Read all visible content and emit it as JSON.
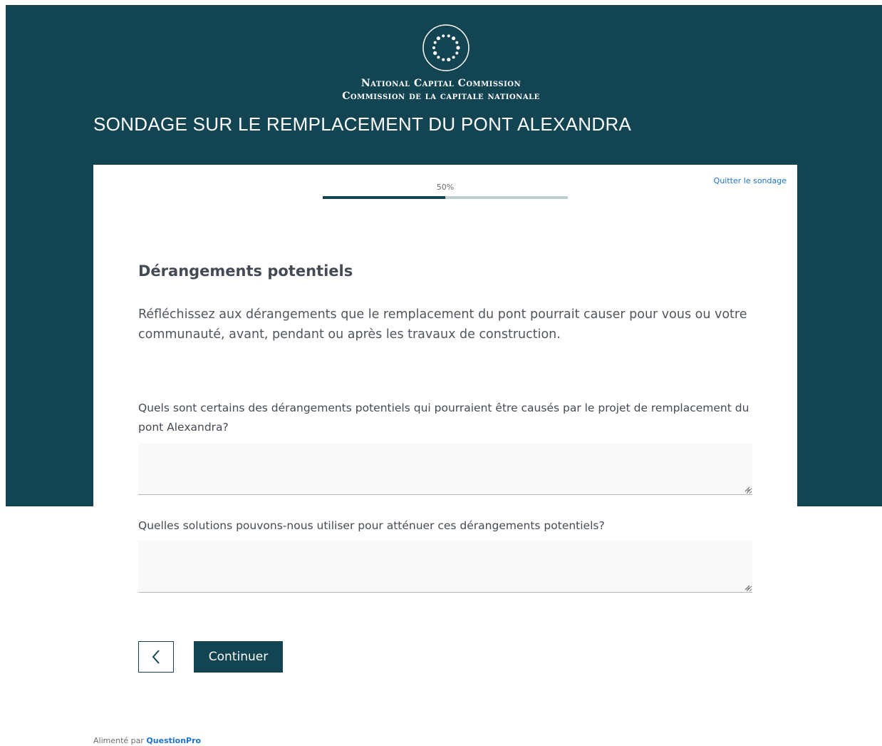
{
  "header": {
    "logo_icon": "ncc-circle-of-dots-logo-icon",
    "org_name_en": "National Capital Commission",
    "org_name_fr": "Commission de la capitale nationale",
    "survey_title": "SONDAGE SUR LE REMPLACEMENT DU PONT ALEXANDRA"
  },
  "progress": {
    "percent": 50,
    "label": "50%"
  },
  "quit_link": "Quitter le sondage",
  "section": {
    "heading": "Dérangements potentiels",
    "intro": "Réfléchissez aux dérangements que le remplacement du pont pourrait causer pour vous ou votre communauté, avant, pendant ou après les travaux de construction."
  },
  "questions": [
    {
      "label": "Quels sont certains des dérangements potentiels qui pourraient être causés par le projet de remplacement du pont Alexandra?",
      "value": ""
    },
    {
      "label": "Quelles solutions pouvons-nous utiliser pour atténuer ces dérangements potentiels?",
      "value": ""
    }
  ],
  "navigation": {
    "back_icon": "chevron-left-icon",
    "continue_label": "Continuer"
  },
  "footer": {
    "prefix": "Alimenté par",
    "link": "QuestionPro"
  },
  "colors": {
    "banner": "#134452",
    "progress_track": "#bfcfd1",
    "link": "#1b73c7"
  }
}
